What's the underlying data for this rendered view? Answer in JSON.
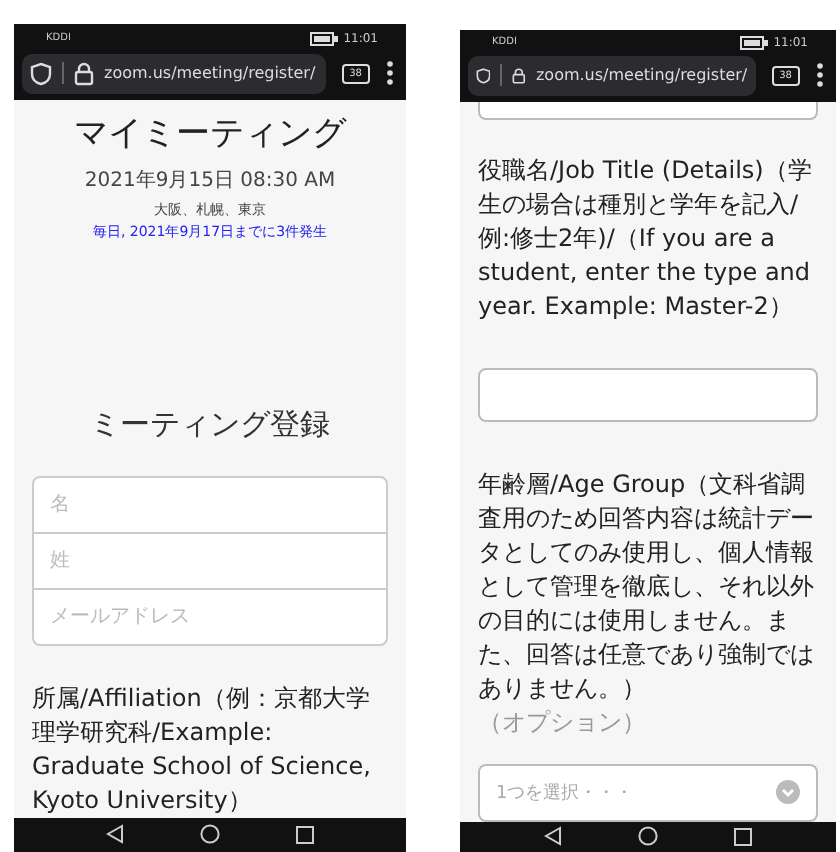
{
  "phones": [
    {
      "status_bar": {
        "carrier": "KDDI",
        "time": "11:01"
      },
      "address_bar": {
        "url": "zoom.us/meeting/register/",
        "tab_count": "38"
      },
      "content": {
        "kind": "registration",
        "title": "マイミーティング",
        "date": "2021年9月15日 08:30 AM",
        "locations": "大阪、札幌、東京",
        "recurrence": "毎日, 2021年9月17日までに3件発生",
        "form_title": "ミーティング登録",
        "fields": [
          {
            "placeholder": "名"
          },
          {
            "placeholder": "姓"
          },
          {
            "placeholder": "メールアドレス"
          }
        ],
        "question": "所属/Affiliation（例：京都大学理学研究科/Example: Graduate School of Science, Kyoto University）"
      }
    },
    {
      "status_bar": {
        "carrier": "KDDI",
        "time": "11:01"
      },
      "address_bar": {
        "url": "zoom.us/meeting/register/",
        "tab_count": "38"
      },
      "content": {
        "kind": "questions",
        "job_label": "役職名/Job Title (Details)（学生の場合は種別と学年を記入/例:修士2年)/（If you are a student, enter the type and year. Example: Master-2）",
        "age_label": "年齢層/Age Group（文科省調査用のため回答内容は統計データとしてのみ使用し、個人情報として管理を徹底し、それ以外の目的には使用しません。また、回答は任意であり強制ではありません。）",
        "optional": "（オプション）",
        "select": {
          "placeholder": "1つを選択・・・"
        }
      }
    }
  ]
}
